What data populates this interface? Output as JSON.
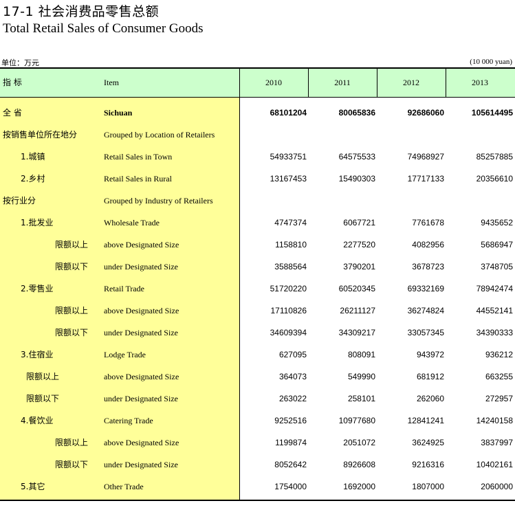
{
  "title_cn": "17-1  社会消费品零售总额",
  "title_en": "Total Retail Sales of Consumer Goods",
  "unit_cn": "单位：万元",
  "unit_en": "(10 000 yuan)",
  "header": {
    "item_cn": "指    标",
    "item_en": "Item",
    "years": [
      "2010",
      "2011",
      "2012",
      "2013"
    ]
  },
  "rows": [
    {
      "cn": "全    省",
      "en": "Sichuan",
      "bold": true,
      "values": [
        "68101204",
        "80065836",
        "92686060",
        "105614495"
      ]
    },
    {
      "cn": "按销售单位所在地分",
      "en": "Grouped by Location of Retailers",
      "values": [
        "",
        "",
        "",
        ""
      ]
    },
    {
      "cn": "1.城镇",
      "en": " Retail Sales in Town",
      "values": [
        "54933751",
        "64575533",
        "74968927",
        "85257885"
      ]
    },
    {
      "cn": "2.乡村",
      "en": " Retail Sales in Rural",
      "values": [
        "13167453",
        "15490303",
        "17717133",
        "20356610"
      ]
    },
    {
      "cn": "按行业分",
      "en": "Grouped by Industry of Retailers",
      "values": [
        "",
        "",
        "",
        ""
      ]
    },
    {
      "cn": "1.批发业",
      "en": "Wholesale Trade",
      "values": [
        "4747374",
        "6067721",
        "7761678",
        "9435652"
      ]
    },
    {
      "cn": "限额以上",
      "en": "above Designated Size",
      "values": [
        "1158810",
        "2277520",
        "4082956",
        "5686947"
      ]
    },
    {
      "cn": "限额以下",
      "en": "under Designated Size",
      "values": [
        "3588564",
        "3790201",
        "3678723",
        "3748705"
      ]
    },
    {
      "cn": "2.零售业",
      "en": "Retail  Trade",
      "values": [
        "51720220",
        "60520345",
        "69332169",
        "78942474"
      ]
    },
    {
      "cn": "限额以上",
      "en": "above Designated Size",
      "values": [
        "17110826",
        "26211127",
        "36274824",
        "44552141"
      ]
    },
    {
      "cn": "限额以下",
      "en": "under Designated Size",
      "values": [
        "34609394",
        "34309217",
        "33057345",
        "34390333"
      ]
    },
    {
      "cn": "3.住宿业",
      "en": "Lodge Trade",
      "values": [
        "627095",
        "808091",
        "943972",
        "936212"
      ]
    },
    {
      "cn": "限额以上",
      "en": "above Designated Size",
      "values": [
        "364073",
        "549990",
        "681912",
        "663255"
      ]
    },
    {
      "cn": "限额以下",
      "en": "under Designated Size",
      "values": [
        "263022",
        "258101",
        "262060",
        "272957"
      ]
    },
    {
      "cn": "4.餐饮业",
      "en": "Catering Trade",
      "values": [
        "9252516",
        "10977680",
        "12841241",
        "14240158"
      ]
    },
    {
      "cn": "限额以上",
      "en": "above Designated Size",
      "values": [
        "1199874",
        "2051072",
        "3624925",
        "3837997"
      ]
    },
    {
      "cn": "限额以下",
      "en": "under Designated Size",
      "values": [
        "8052642",
        "8926608",
        "9216316",
        "10402161"
      ]
    },
    {
      "cn": "5.其它",
      "en": "Other Trade",
      "values": [
        "1754000",
        "1692000",
        "1807000",
        "2060000"
      ]
    }
  ]
}
